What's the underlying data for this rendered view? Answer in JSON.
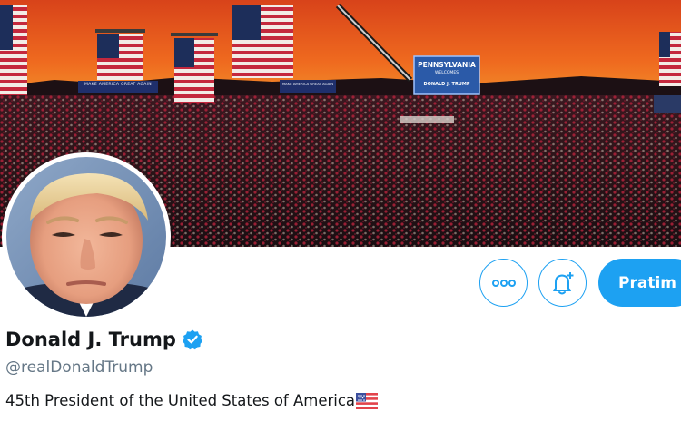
{
  "profile": {
    "display_name": "Donald J. Trump",
    "handle": "@realDonaldTrump",
    "bio": "45th President of the United States of America",
    "bio_emoji": "us-flag-icon",
    "verified": true
  },
  "banner": {
    "sign_main": "PENNSYLVANIA",
    "sign_sub": "WELCOMES",
    "sign_bottom": "DONALD J. TRUMP",
    "banner_left": "MAKE AMERICA GREAT AGAIN",
    "banner_right": "MAKE AMERICA GREAT AGAIN"
  },
  "actions": {
    "more_icon": "more-icon",
    "notify_icon": "bell-plus-icon",
    "follow_label": "Pratim"
  },
  "colors": {
    "accent": "#1da1f2",
    "text_primary": "#14171a",
    "text_secondary": "#657786"
  }
}
